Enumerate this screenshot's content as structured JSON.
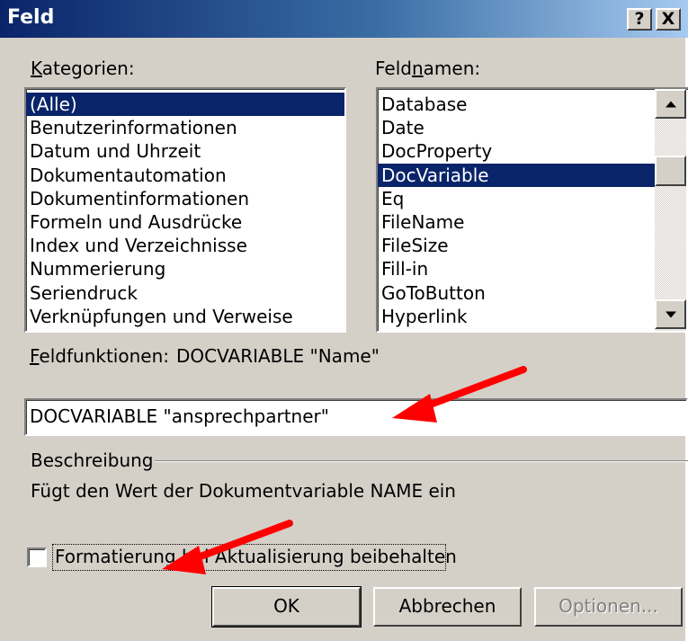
{
  "window": {
    "title": "Feld",
    "help_button": "?",
    "close_button": "X"
  },
  "kategorien": {
    "label": "Kategorien:",
    "items": [
      "(Alle)",
      "Benutzerinformationen",
      "Datum und Uhrzeit",
      "Dokumentautomation",
      "Dokumentinformationen",
      "Formeln und Ausdrücke",
      "Index und Verzeichnisse",
      "Nummerierung",
      "Seriendruck",
      "Verknüpfungen und Verweise"
    ],
    "selected": "(Alle)"
  },
  "feldnamen": {
    "label": "Feldnamen:",
    "items": [
      "Database",
      "Date",
      "DocProperty",
      "DocVariable",
      "Eq",
      "FileName",
      "FileSize",
      "Fill-in",
      "GoToButton",
      "Hyperlink"
    ],
    "selected": "DocVariable"
  },
  "feldfunktionen": {
    "label": "Feldfunktionen:",
    "syntax": "DOCVARIABLE \"Name\"",
    "value": "DOCVARIABLE \"ansprechpartner\""
  },
  "beschreibung": {
    "label": "Beschreibung",
    "text": "Fügt den Wert der Dokumentvariable NAME ein"
  },
  "formatierung": {
    "label": "Formatierung bei Aktualisierung beibehalten",
    "checked": false
  },
  "buttons": {
    "ok": "OK",
    "cancel": "Abbrechen",
    "options": "Optionen..."
  },
  "annotation_color": "#ff0000"
}
